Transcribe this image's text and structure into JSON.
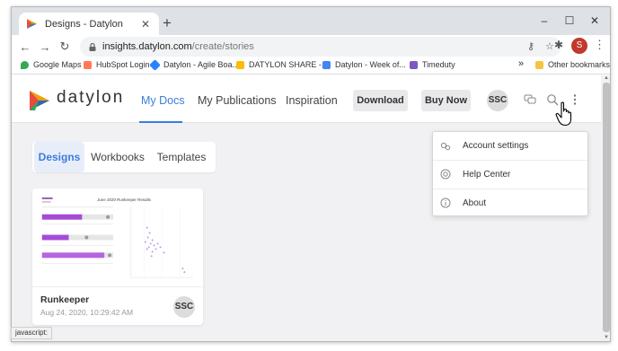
{
  "browser": {
    "tab_title": "Designs - Datylon",
    "url_host": "insights.datylon.com",
    "url_path": "/create/stories",
    "profile_initial": "S",
    "status_text": "javascript:",
    "bookmarks": [
      "Google Maps",
      "HubSpot Login",
      "Datylon - Agile Boa...",
      "DATYLON SHARE -...",
      "Datylon - Week of...",
      "Timeduty"
    ],
    "bookmarks_overflow": "»",
    "other_bookmarks": "Other bookmarks"
  },
  "app": {
    "brand": "datylon",
    "nav": [
      "My Docs",
      "My Publications",
      "Inspiration"
    ],
    "download_label": "Download",
    "buynow_label": "Buy Now",
    "avatar_initials": "SSC",
    "accent": "#3b7ddd",
    "subtabs": [
      "Designs",
      "Workbooks",
      "Templates"
    ],
    "card": {
      "title": "Runkeeper",
      "date": "Aug 24, 2020, 10:29:42 AM",
      "avatar": "SSC",
      "thumb_title": "June 2020 Runkeeper Results"
    },
    "menu": [
      "Account settings",
      "Help Center",
      "About"
    ]
  }
}
